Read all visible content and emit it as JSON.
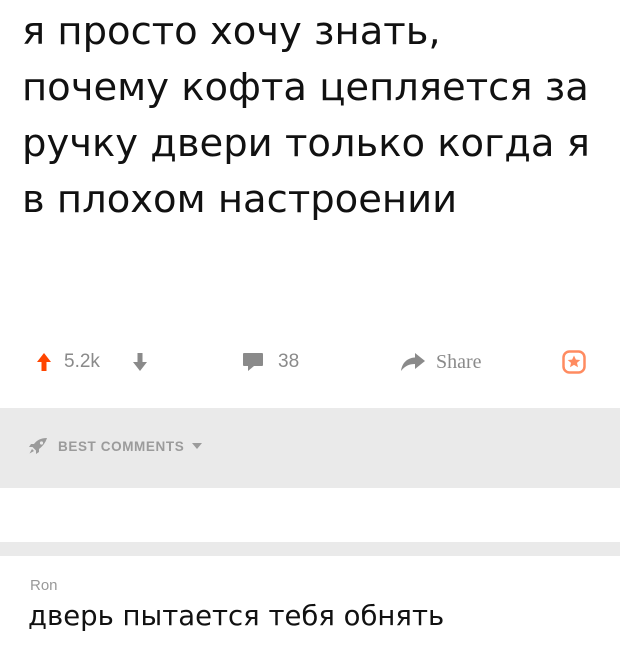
{
  "post": {
    "title_lines": [
      "я просто хочу знать,",
      "почему кофта цепляется за",
      "ручку двери только когда я",
      "в плохом настроении"
    ]
  },
  "actions": {
    "score": "5.2k",
    "comments_count": "38",
    "share_label": "Share",
    "icons": {
      "upvote": "arrow-up-icon",
      "downvote": "arrow-down-icon",
      "comments": "speech-bubble-icon",
      "share": "share-arrow-icon",
      "save": "star-icon"
    },
    "colors": {
      "upvote": "#ff4500",
      "muted": "#8a8a8a",
      "save": "#ff8b60"
    }
  },
  "comments_section": {
    "sort_label": "BEST COMMENTS",
    "sort_icon": "rocket-icon",
    "comment": {
      "author": "Ron",
      "text": "дверь пытается тебя обнять"
    }
  }
}
